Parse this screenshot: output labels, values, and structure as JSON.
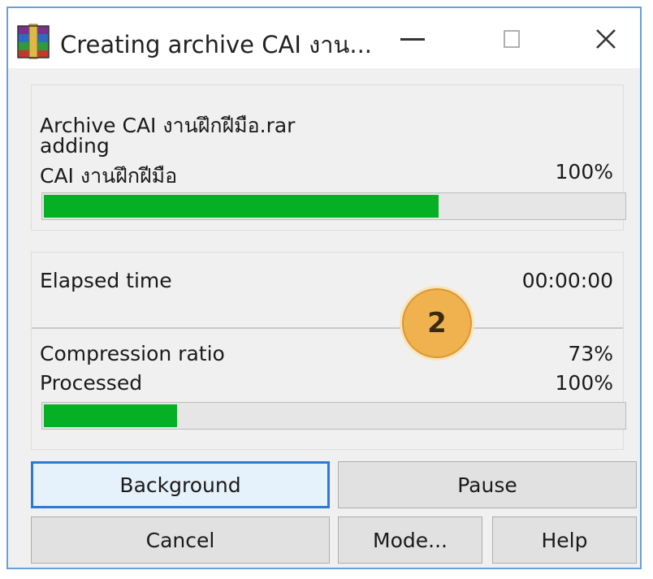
{
  "window": {
    "title": "Creating archive CAI งาน..."
  },
  "archive_panel": {
    "archive_line": "Archive CAI งานฝึกฝีมือ.rar",
    "status": "adding",
    "current_file": "CAI งานฝึกฝีมือ",
    "file_percent": "100%",
    "file_progress_fraction": 0.68
  },
  "stats_panel": {
    "elapsed_label": "Elapsed time",
    "elapsed_value": "00:00:00",
    "ratio_label": "Compression ratio",
    "ratio_value": "73%",
    "processed_label": "Processed",
    "processed_value": "100%",
    "total_progress_fraction": 0.23
  },
  "annotation": {
    "step_number": "2"
  },
  "buttons": {
    "background": "Background",
    "pause": "Pause",
    "cancel": "Cancel",
    "mode": "Mode...",
    "help": "Help"
  },
  "colors": {
    "progress_fill": "#06b025",
    "focus_border": "#2b7ad6",
    "badge": "#f0b24e"
  }
}
